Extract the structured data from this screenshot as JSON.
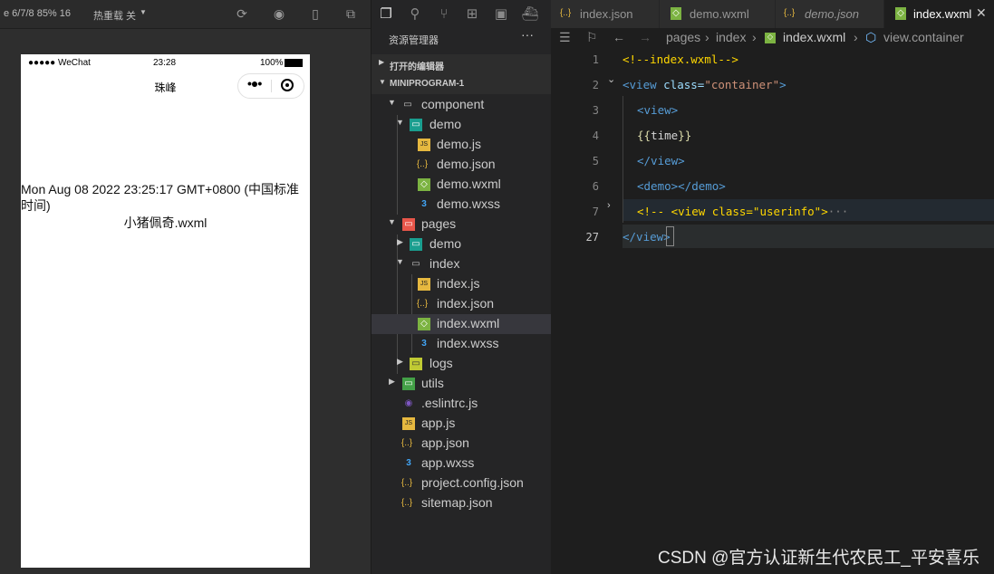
{
  "simulator": {
    "toolbar": {
      "device_info": "e 6/7/8 85% 16",
      "hot_reload": "热重载 关"
    },
    "status_bar": {
      "carrier": "●●●●● WeChat",
      "time": "23:28",
      "battery": "100%"
    },
    "nav_title": "珠峰",
    "content": {
      "time_text": "Mon Aug 08 2022 23:25:17 GMT+0800 (中国标准时间)",
      "component_text": "小猪佩奇.wxml"
    }
  },
  "explorer": {
    "title": "资源管理器",
    "more": "···",
    "sections": {
      "open_editors": "打开的编辑器",
      "project": "MINIPROGRAM-1"
    },
    "tree": [
      {
        "name": "component",
        "icon": "folder-open-icon"
      },
      {
        "name": "demo",
        "icon": "folder-component-icon"
      },
      {
        "name": "demo.js",
        "icon": "js-file-icon"
      },
      {
        "name": "demo.json",
        "icon": "json-file-icon"
      },
      {
        "name": "demo.wxml",
        "icon": "wxml-file-icon"
      },
      {
        "name": "demo.wxss",
        "icon": "css-file-icon"
      },
      {
        "name": "pages",
        "icon": "folder-pages-icon"
      },
      {
        "name": "demo",
        "icon": "folder-component-icon"
      },
      {
        "name": "index",
        "icon": "folder-open-icon"
      },
      {
        "name": "index.js",
        "icon": "js-file-icon"
      },
      {
        "name": "index.json",
        "icon": "json-file-icon"
      },
      {
        "name": "index.wxml",
        "icon": "wxml-file-icon"
      },
      {
        "name": "index.wxss",
        "icon": "css-file-icon"
      },
      {
        "name": "logs",
        "icon": "folder-icon"
      },
      {
        "name": "utils",
        "icon": "folder-utils-icon"
      },
      {
        "name": ".eslintrc.js",
        "icon": "eslint-file-icon"
      },
      {
        "name": "app.js",
        "icon": "js-file-icon"
      },
      {
        "name": "app.json",
        "icon": "json-file-icon"
      },
      {
        "name": "app.wxss",
        "icon": "css-file-icon"
      },
      {
        "name": "project.config.json",
        "icon": "json-file-icon"
      },
      {
        "name": "sitemap.json",
        "icon": "json-file-icon"
      }
    ]
  },
  "editor": {
    "tabs": [
      {
        "label": "index.json",
        "icon": "json-file-icon"
      },
      {
        "label": "demo.wxml",
        "icon": "wxml-file-icon"
      },
      {
        "label": "demo.json",
        "icon": "json-file-icon"
      },
      {
        "label": "index.wxml",
        "icon": "wxml-file-icon",
        "close": "✕"
      }
    ],
    "breadcrumb": {
      "p1": "pages",
      "p2": "index",
      "p3": "index.wxml",
      "p4": "view.container"
    },
    "lines": [
      {
        "num": "1"
      },
      {
        "num": "2"
      },
      {
        "num": "3"
      },
      {
        "num": "4"
      },
      {
        "num": "5"
      },
      {
        "num": "6"
      },
      {
        "num": "7"
      },
      {
        "num": "27"
      }
    ],
    "code": {
      "l1": "<!--index.wxml-->",
      "l2_open": "<view ",
      "l2_attr": "class=",
      "l2_val": "\"container\"",
      "l2_close": ">",
      "l3": "<view>",
      "l4_open": "{{",
      "l4_var": "time",
      "l4_close": "}}",
      "l5": "</view>",
      "l6": "<demo></demo>",
      "l7": "<!-- <view class=\"userinfo\">",
      "l7_more": "···",
      "l27": "</view>"
    }
  },
  "watermark": "CSDN @官方认证新生代农民工_平安喜乐"
}
